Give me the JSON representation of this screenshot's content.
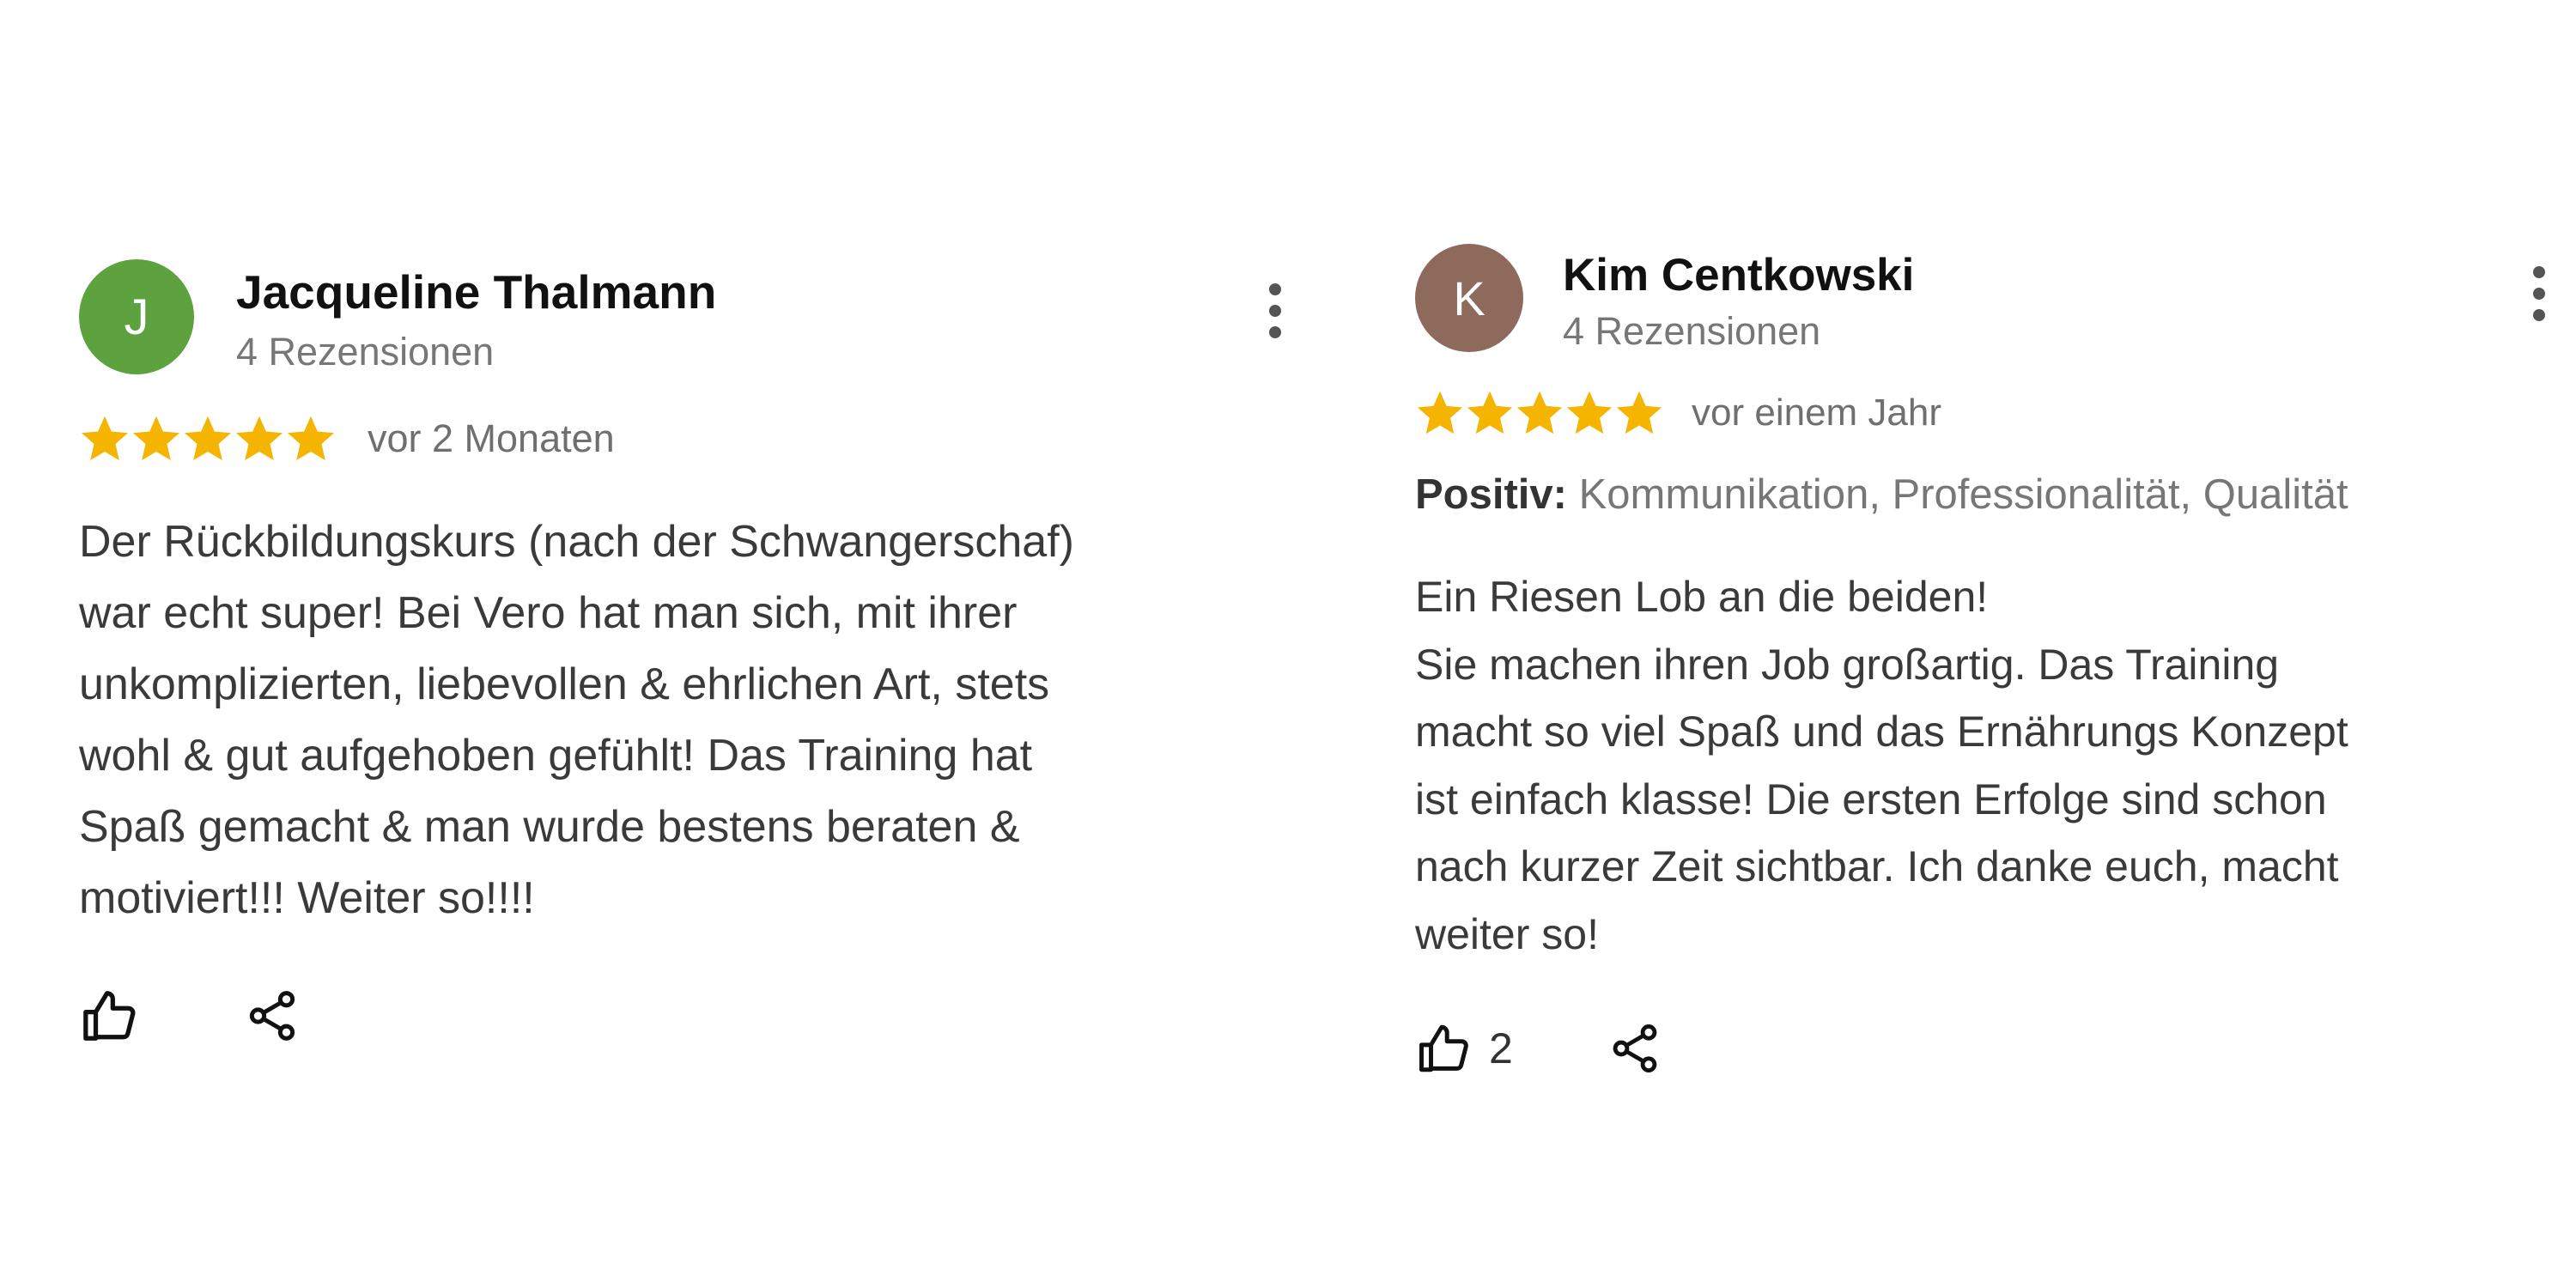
{
  "reviews": [
    {
      "avatar_letter": "J",
      "avatar_color": "#5ea23f",
      "name": "Jacqueline Thalmann",
      "review_count": "4 Rezensionen",
      "rating": 5,
      "date": "vor 2 Monaten",
      "text": "Der Rückbildungskurs (nach der Schwangerschaf)\nwar echt super! Bei Vero hat man sich, mit ihrer\nunkomplizierten, liebevollen & ehrlichen Art, stets\nwohl & gut aufgehoben gefühlt! Das Training hat\nSpaß gemacht & man wurde bestens beraten &\nmotiviert!!! Weiter so!!!!",
      "like_count": "",
      "icons": {
        "more": "more-vert-icon",
        "like": "thumb-up-icon",
        "share": "share-icon"
      }
    },
    {
      "avatar_letter": "K",
      "avatar_color": "#8d6a5c",
      "name": "Kim Centkowski",
      "review_count": "4 Rezensionen",
      "rating": 5,
      "date": "vor einem Jahr",
      "positive_label": "Positiv:",
      "positive_text": "Kommunikation, Professionalität, Qualität",
      "text": "Ein Riesen Lob an die beiden!\nSie machen ihren Job großartig. Das Training\nmacht so viel Spaß und das Ernährungs Konzept\nist einfach klasse! Die ersten Erfolge sind schon\nnach kurzer Zeit sichtbar. Ich danke euch, macht\nweiter so!",
      "like_count": "2",
      "icons": {
        "more": "more-vert-icon",
        "like": "thumb-up-icon",
        "share": "share-icon"
      }
    }
  ],
  "star_color": "#f4b400"
}
